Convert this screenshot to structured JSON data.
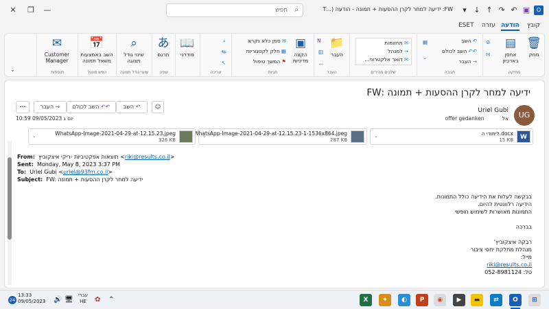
{
  "titlebar": {
    "title": "FW: ידיעה למחר לקרן ההסעות + תמונה  -  הודעה (...HT",
    "search_placeholder": "חפש"
  },
  "ribbon_tabs": [
    {
      "label": "קובץ",
      "active": false
    },
    {
      "label": "הודעה",
      "active": true
    },
    {
      "label": "עזרה",
      "active": false
    },
    {
      "label": "ESET",
      "active": false
    }
  ],
  "ribbon": {
    "groups": {
      "delete": "מחיקה",
      "respond": "תגובה",
      "quicksteps": "שלבים מהירים",
      "move": "העבר",
      "tags": "תגיות",
      "editing": "עריכה",
      "language": "שפה",
      "zoom": "שינוי גודל תצוגה",
      "protection": "הפש מעגל",
      "addins": "תוספות"
    },
    "delete": {
      "delete_label": "מחק",
      "archive_label": "אחסן בארכיון"
    },
    "respond": {
      "reply": "השב",
      "reply_all": "השב לכולם",
      "forward": "העבר"
    },
    "quicksteps": {
      "items": [
        "תחזומות",
        "למנהל",
        "דואר אלקטרוני..."
      ]
    },
    "move": {
      "move_label": "העבר"
    },
    "tags": {
      "policy_label": "הקצה מדיניות",
      "mark_unread": "סמן כלא נקרא",
      "categorize": "חלק לקטגוריות",
      "followup": "המשך טיפול"
    },
    "language": {
      "translate_label": "תרגם"
    },
    "immersive": {
      "label": "מודרני"
    },
    "zoom": {
      "label": "שינוי גודל תצוגה"
    },
    "reply_meeting": {
      "label": "השב באמצעות משאל תמונה"
    },
    "addins": {
      "label": "Customer Manager"
    }
  },
  "message": {
    "subject": "ידיעה למחר לקרן ההסעות + תמונה :FW",
    "actions": {
      "reply": "השב",
      "reply_all": "השב לכולם",
      "forward": "העבר",
      "more": "···"
    },
    "avatar_initials": "UG",
    "sender": "Uriel Gubi",
    "recipient_prefix": "אל",
    "recipient": "offer gedanken",
    "datetime": "יום ג 09/05/2023 10:59",
    "attachments": [
      {
        "name": "לימודי ה.docx",
        "size": "15 KB",
        "type": "docx"
      },
      {
        "name": "WhatsApp-Image-2021-04-29-at-12.15.23-1-1536x864.jpeg",
        "size": "287 KB",
        "type": "jpeg"
      },
      {
        "name": "WhatsApp-Image-2021-04-29-at-12.15.23.jpeg",
        "size": "326 KB",
        "type": "jpeg"
      }
    ],
    "headers": {
      "from_label": "From:",
      "from_value": "תוצאות אפקטיביות -ריקי איצקוביץ <",
      "from_email": "riki@results.co.il",
      "from_tail": ">",
      "sent_label": "Sent:",
      "sent_value": "Monday, May 8, 2023 3:37 PM",
      "to_label": "To:",
      "to_value": "Uriel Gubi <",
      "to_email": "uriel@93fm.co.il",
      "to_tail": ">",
      "subject_label": "Subject:",
      "subject_value": "FW: ידיעה למחר לקרן ההסעות + תמונה"
    },
    "body_lines": [
      "בבקשה לעלות את הידיעה כולל התמונות.",
      "הידיעה רלוונטית להיום.",
      "התמונות  מאושרות לשימוש חופשי"
    ],
    "signoff": "בברכה",
    "signature": {
      "name": "רבקה איצקוביץ'",
      "title": "מנהלת מחלקת יחסי ציבור",
      "email_label": "מייל:",
      "email": "riki@results.co.il",
      "phone_label": "טל:",
      "phone": "052-8981124"
    }
  },
  "taskbar": {
    "notification_count": "24",
    "time": "13:33",
    "date": "09/05/2023",
    "lang_top": "עברי",
    "lang_bottom": "HE"
  },
  "colors": {
    "accent": "#0f5ea8",
    "avatar_bg": "#8a5a3c",
    "link": "#0563c1"
  }
}
